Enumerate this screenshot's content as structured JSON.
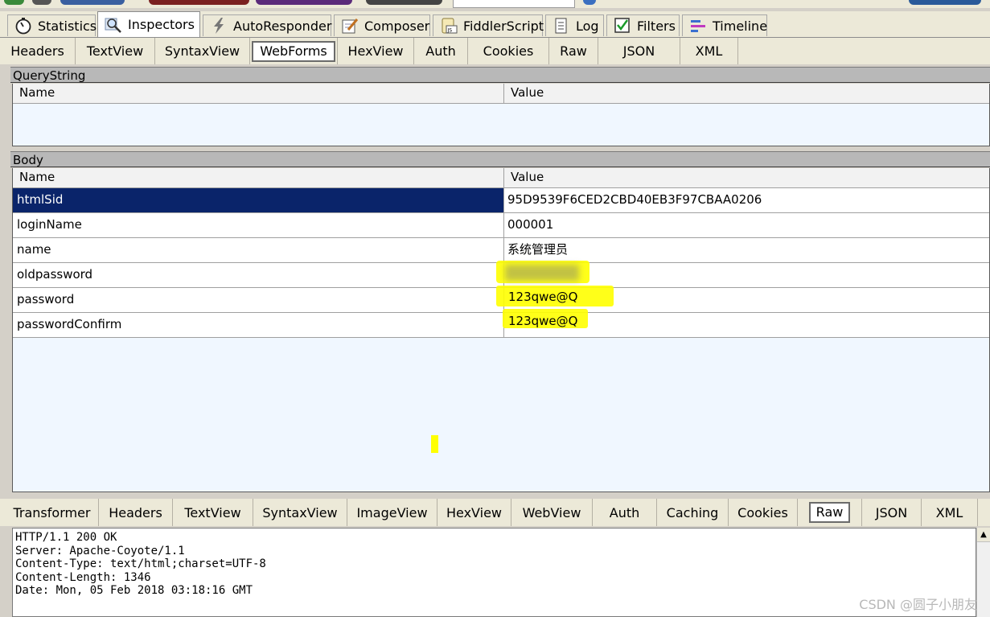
{
  "main_tabs": [
    {
      "label": "Statistics",
      "icon": "stopwatch-icon"
    },
    {
      "label": "Inspectors",
      "icon": "magnifier-icon"
    },
    {
      "label": "AutoResponder",
      "icon": "lightning-icon"
    },
    {
      "label": "Composer",
      "icon": "pencil-icon"
    },
    {
      "label": "FiddlerScript",
      "icon": "script-icon"
    },
    {
      "label": "Log",
      "icon": "log-icon"
    },
    {
      "label": "Filters",
      "icon": "checkbox-icon"
    },
    {
      "label": "Timeline",
      "icon": "timeline-icon"
    }
  ],
  "request_tabs": [
    "Headers",
    "TextView",
    "SyntaxView",
    "WebForms",
    "HexView",
    "Auth",
    "Cookies",
    "Raw",
    "JSON",
    "XML"
  ],
  "request_active": "WebForms",
  "querystring": {
    "title": "QueryString",
    "col_name": "Name",
    "col_value": "Value"
  },
  "body": {
    "title": "Body",
    "col_name": "Name",
    "col_value": "Value",
    "rows": [
      {
        "name": "htmlSid",
        "value": "95D9539F6CED2CBD40EB3F97CBAA0206"
      },
      {
        "name": "loginName",
        "value": "000001"
      },
      {
        "name": "name",
        "value": "系统管理员"
      },
      {
        "name": "oldpassword",
        "value": ""
      },
      {
        "name": "password",
        "value": "123qwe@Q"
      },
      {
        "name": "passwordConfirm",
        "value": "123qwe@Q"
      }
    ],
    "selected_row": 0
  },
  "response_tabs": [
    "Transformer",
    "Headers",
    "TextView",
    "SyntaxView",
    "ImageView",
    "HexView",
    "WebView",
    "Auth",
    "Caching",
    "Cookies",
    "Raw",
    "JSON",
    "XML"
  ],
  "response_active": "Raw",
  "raw_response": [
    "HTTP/1.1 200 OK",
    "Server: Apache-Coyote/1.1",
    "Content-Type: text/html;charset=UTF-8",
    "Content-Length: 1346",
    "Date: Mon, 05 Feb 2018 03:18:16 GMT"
  ],
  "watermark": "CSDN @圆子小朋友",
  "colors": {
    "selection": "#0a246a",
    "highlight": "#ffff00",
    "grid_bg": "#f0f7ff"
  }
}
